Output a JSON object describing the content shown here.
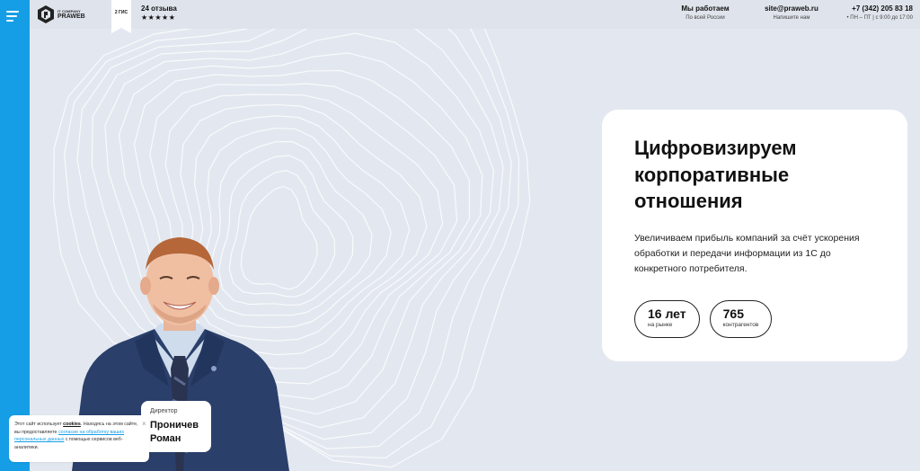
{
  "header": {
    "logo": {
      "small": "IT COMPANY",
      "big": "PRAWEB"
    },
    "gis_badge": "2 ГИС",
    "reviews_count": "24 отзыва",
    "stars": "★★★★★",
    "regions": {
      "main": "Мы работаем",
      "sub": "По всей России"
    },
    "email": {
      "main": "site@praweb.ru",
      "sub": "Напишите нам"
    },
    "phone": {
      "main": "+7 (342) 205 83 18",
      "sub": "• ПН – ПТ | с 9:00 до 17:00"
    }
  },
  "hero": {
    "title_lines": [
      "Цифровизируем",
      "корпоративные",
      "отношения"
    ],
    "description": "Увеличиваем прибыль компаний за счёт ускорения обработки и передачи информации из 1С до конкретного потребителя.",
    "stats": [
      {
        "number": "16 лет",
        "label": "на рынке"
      },
      {
        "number": "765",
        "label": "контрагентов"
      }
    ]
  },
  "person": {
    "role": "Директор",
    "name_line1": "Проничев",
    "name_line2": "Роман"
  },
  "cookie": {
    "text_1": "Этот сайт использует ",
    "cookies_word": "cookies",
    "text_2": ". Находясь на этом сайте, вы предоставляете ",
    "link": "согласие на обработку ваших персональных данных",
    "text_3": " с помощью сервисов веб-аналитики.",
    "close": "×"
  },
  "colors": {
    "accent": "#159ee6",
    "background": "#e3e8f0",
    "card": "#ffffff"
  }
}
